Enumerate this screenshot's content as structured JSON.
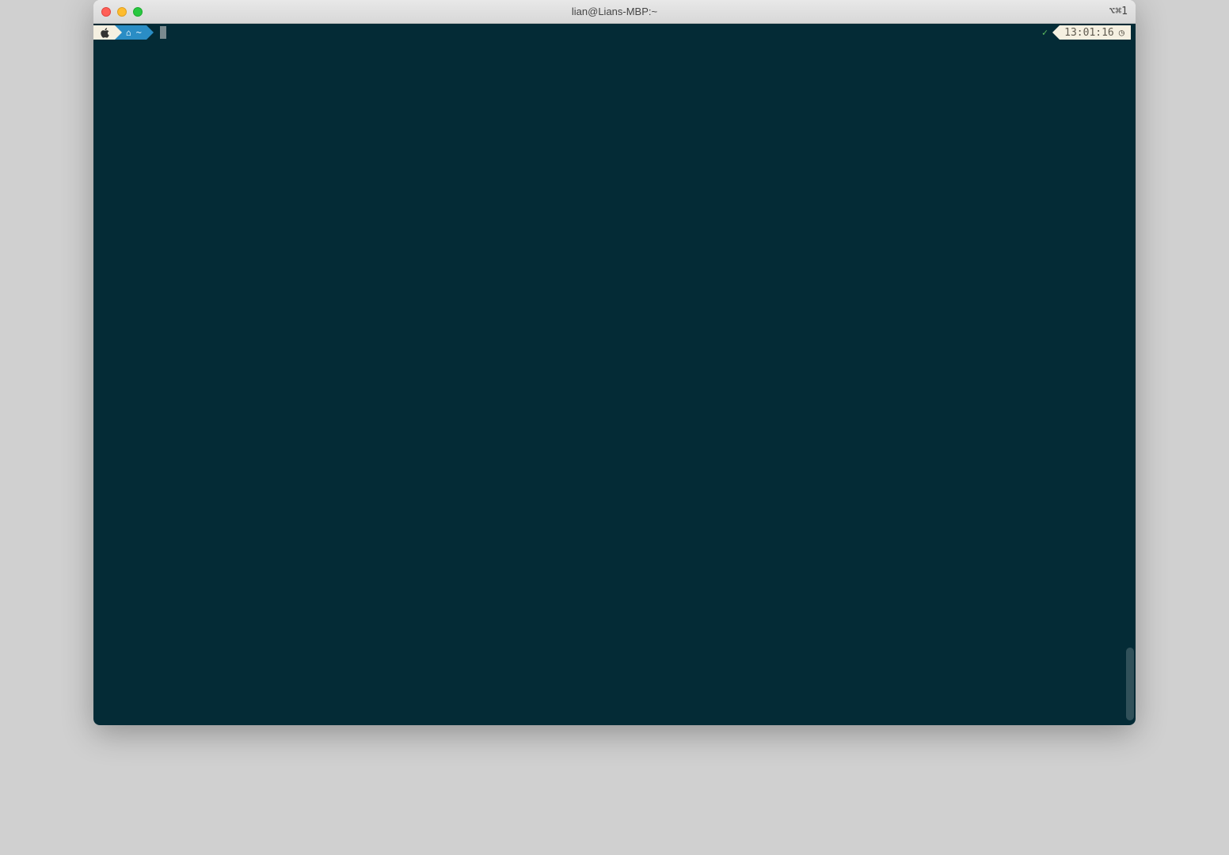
{
  "window": {
    "title": "lian@Lians-MBP:~",
    "hotkey_hint": "⌥⌘1"
  },
  "prompt": {
    "os_icon": "apple-logo",
    "home_icon": "⌂",
    "path": "~",
    "cursor": " "
  },
  "right_status": {
    "check": "✓",
    "time": "13:01:16",
    "clock_icon": "◷"
  },
  "colors": {
    "terminal_bg": "#042b36",
    "segment_light": "#f5f0e1",
    "segment_blue": "#2a8dc5"
  }
}
